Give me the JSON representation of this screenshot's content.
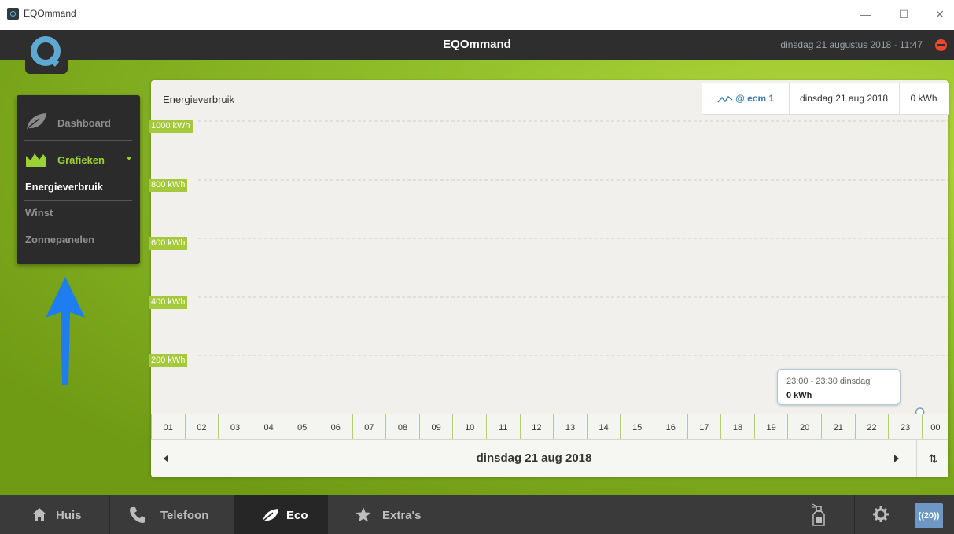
{
  "window": {
    "title": "EQOmmand",
    "minimize": "—",
    "maximize": "☐",
    "close": "✕"
  },
  "header": {
    "title": "EQOmmand",
    "datetime": "dinsdag 21 augustus 2018 - 11:47"
  },
  "sidebar": {
    "dashboard": "Dashboard",
    "grafieken": "Grafieken",
    "items": [
      {
        "label": "Energieverbruik",
        "active": true
      },
      {
        "label": "Winst",
        "active": false
      },
      {
        "label": "Zonnepanelen",
        "active": false
      }
    ]
  },
  "panel": {
    "title": "Energieverbruik",
    "legend": {
      "series": "@ ecm 1",
      "date": "dinsdag 21 aug 2018",
      "value": "0 kWh"
    },
    "nav_date": "dinsdag 21 aug 2018",
    "sort_label": "⇅",
    "tooltip": {
      "range": "23:00 - 23:30 dinsdag",
      "value": "0 kWh"
    }
  },
  "chart_data": {
    "type": "line",
    "title": "Energieverbruik",
    "ylim": [
      0,
      1000
    ],
    "yticks": [
      {
        "value": 1000,
        "label": "1000 kWh"
      },
      {
        "value": 800,
        "label": "800 kWh"
      },
      {
        "value": 600,
        "label": "600 kWh"
      },
      {
        "value": 400,
        "label": "400 kWh"
      },
      {
        "value": 200,
        "label": "200 kWh"
      }
    ],
    "categories": [
      "01",
      "02",
      "03",
      "04",
      "05",
      "06",
      "07",
      "08",
      "09",
      "10",
      "11",
      "12",
      "13",
      "14",
      "15",
      "16",
      "17",
      "18",
      "19",
      "20",
      "21",
      "22",
      "23",
      "00"
    ],
    "series": [
      {
        "name": "@ ecm 1",
        "values": [
          0,
          0,
          0,
          0,
          0,
          0,
          0,
          0,
          0,
          0,
          0,
          0,
          0,
          0,
          0,
          0,
          0,
          0,
          0,
          0,
          0,
          0,
          0,
          0
        ]
      }
    ],
    "grid": true
  },
  "bottom_nav": [
    {
      "label": "Huis",
      "icon": "home-icon"
    },
    {
      "label": "Telefoon",
      "icon": "phone-icon"
    },
    {
      "label": "Eco",
      "icon": "leaf-icon",
      "active": true
    },
    {
      "label": "Extra's",
      "icon": "star-icon"
    }
  ],
  "badge": "((20))",
  "colors": {
    "accent_green": "#9bd233",
    "header_dark": "#2e2e2e",
    "blue": "#5da9d2",
    "arrow_blue": "#1e7df0"
  }
}
